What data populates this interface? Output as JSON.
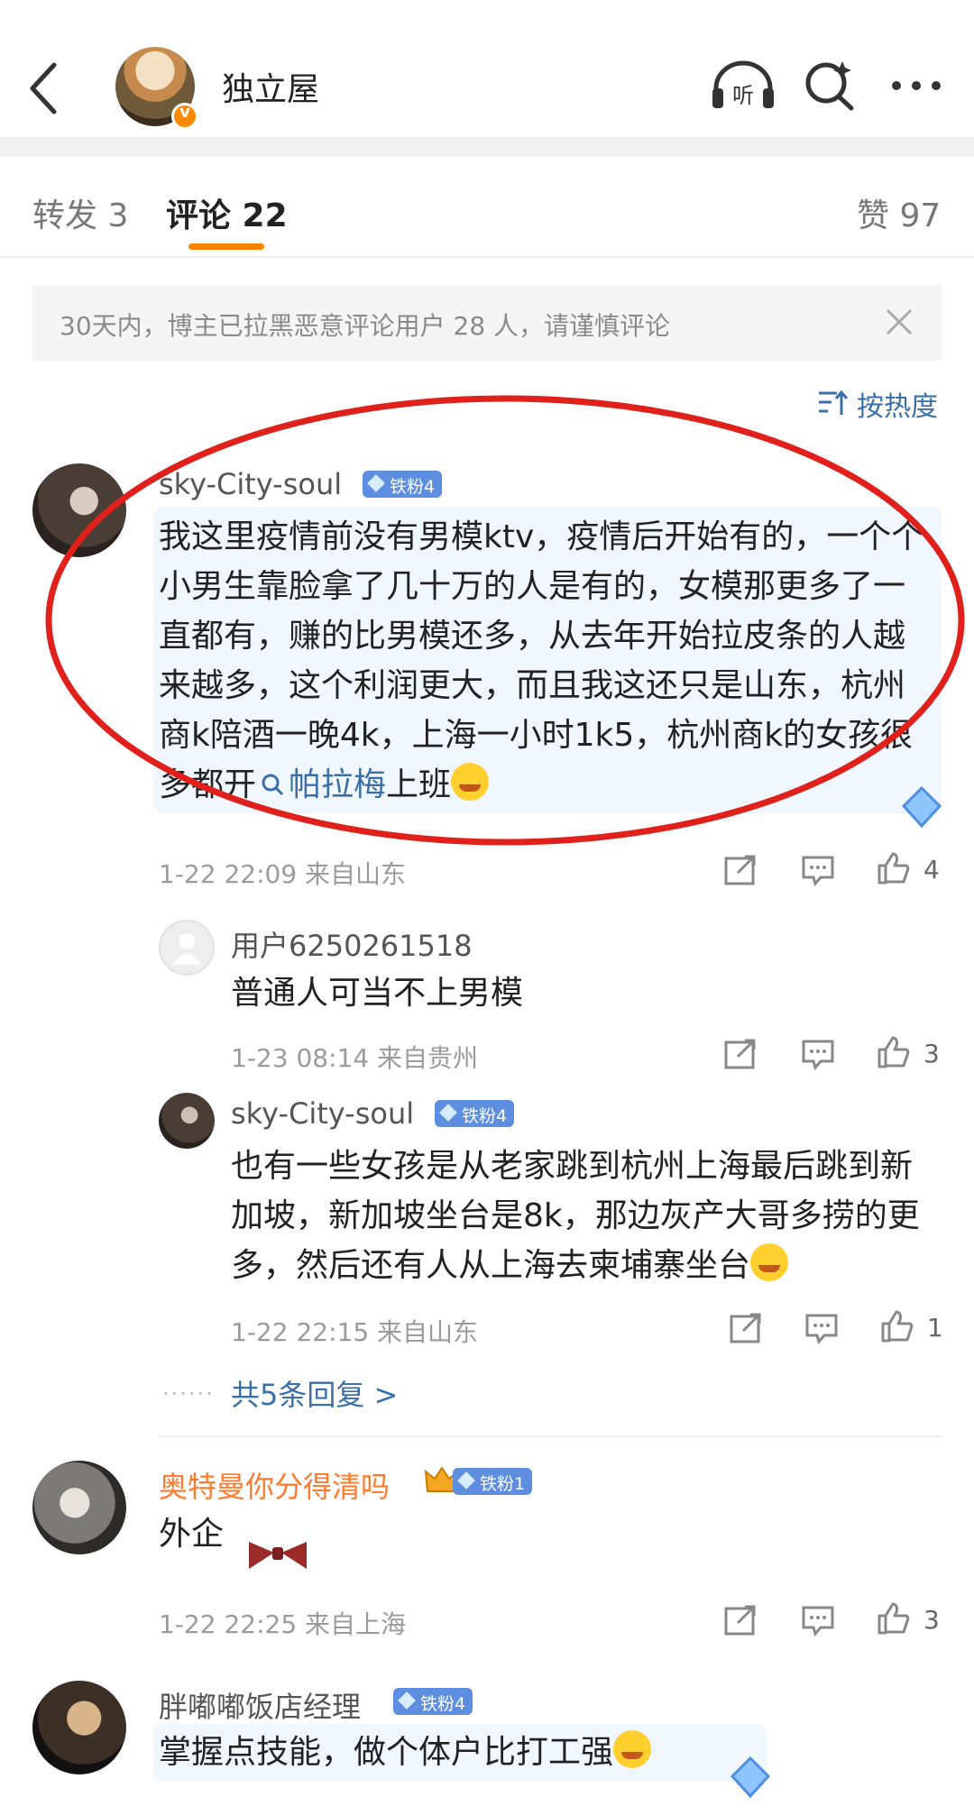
{
  "header": {
    "title": "独立屋"
  },
  "tabs": [
    {
      "label": "转发 3"
    },
    {
      "label": "评论 22"
    },
    {
      "label": "赞 97"
    }
  ],
  "header_icons": {
    "listen_label": "听"
  },
  "notice": {
    "text": "30天内，博主已拉黑恶意评论用户 28 人，请谨慎评论"
  },
  "sort": {
    "label": "按热度"
  },
  "comments": [
    {
      "name": "sky-City-soul",
      "badge": "铁粉4",
      "text_before_link": "我这里疫情前没有男模ktv，疫情后开始有的，一个个小男生靠脸拿了几十万的人是有的，女模那更多了一直都有，赚的比男模还多，从去年开始拉皮条的人越来越多，这个利润更大，而且我这还只是山东，杭州商k陪酒一晚4k，上海一小时1k5，杭州商k的女孩很多都开",
      "link": "帕拉梅",
      "text_after_link": "上班",
      "meta": "1-22 22:09 来自山东",
      "likes": "4",
      "replies": [
        {
          "name": "用户6250261518",
          "text": "普通人可当不上男模",
          "meta": "1-23 08:14 来自贵州",
          "likes": "3"
        },
        {
          "name": "sky-City-soul",
          "badge": "铁粉4",
          "text": "也有一些女孩是从老家跳到杭州上海最后跳到新加坡，新加坡坐台是8k，那边灰产大哥多捞的更多，然后还有人从上海去柬埔寨坐台",
          "meta": "1-22 22:15 来自山东",
          "likes": "1"
        }
      ],
      "more_replies": "共5条回复 >"
    },
    {
      "name": "奥特曼你分得清吗",
      "badge": "铁粉1",
      "text": "外企",
      "meta": "1-22 22:25 来自上海",
      "likes": "3"
    },
    {
      "name": "胖嘟嘟饭店经理",
      "badge": "铁粉4",
      "text": "掌握点技能，做个体户比打工强"
    }
  ],
  "colors": {
    "accent": "#ff8200",
    "link": "#3a6fa8",
    "annotation": "#e0201a",
    "badge": "#5d8ee0"
  }
}
